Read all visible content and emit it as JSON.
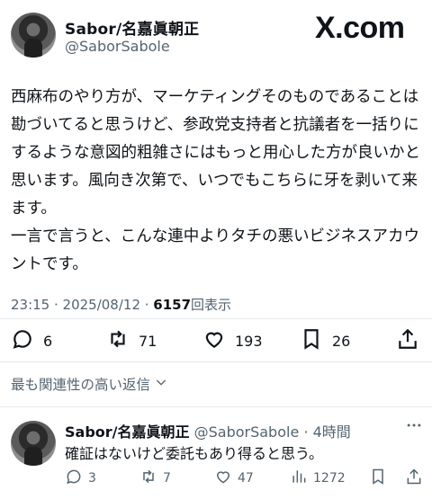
{
  "brand": {
    "site_label": "X.com"
  },
  "post": {
    "author_name": "Sabor/名嘉眞朝正",
    "author_handle": "@SaborSabole",
    "text": "西麻布のやり方が、マーケティングそのものであることは勘づいてると思うけど、参政党支持者と抗議者を一括りにするような意図的粗雑さにはもっと用心した方が良いかと思います。風向き次第で、いつでもこちらに牙を剥いて来ます。\n一言で言うと、こんな連中よりタチの悪いビジネスアカウントです。",
    "timestamp": "23:15 · 2025/08/12 · ",
    "views_count": "6157",
    "views_label": "回表示",
    "actions": {
      "replies": "6",
      "reposts": "71",
      "likes": "193",
      "bookmarks": "26"
    }
  },
  "sort": {
    "label": "最も関連性の高い返信"
  },
  "reply": {
    "author_name": "Sabor/名嘉眞朝正",
    "author_handle": "@SaborSabole",
    "time": "· 4時間",
    "text": "確証はないけど委託もあり得ると思う。",
    "actions": {
      "replies": "3",
      "reposts": "7",
      "likes": "47",
      "views": "1272"
    }
  },
  "icons": {
    "reply": "comment-icon",
    "repost": "repost-icon",
    "like": "heart-icon",
    "bookmark": "bookmark-icon",
    "share": "share-icon",
    "views": "views-icon",
    "more": "more-icon",
    "chevron": "chevron-down-icon"
  }
}
